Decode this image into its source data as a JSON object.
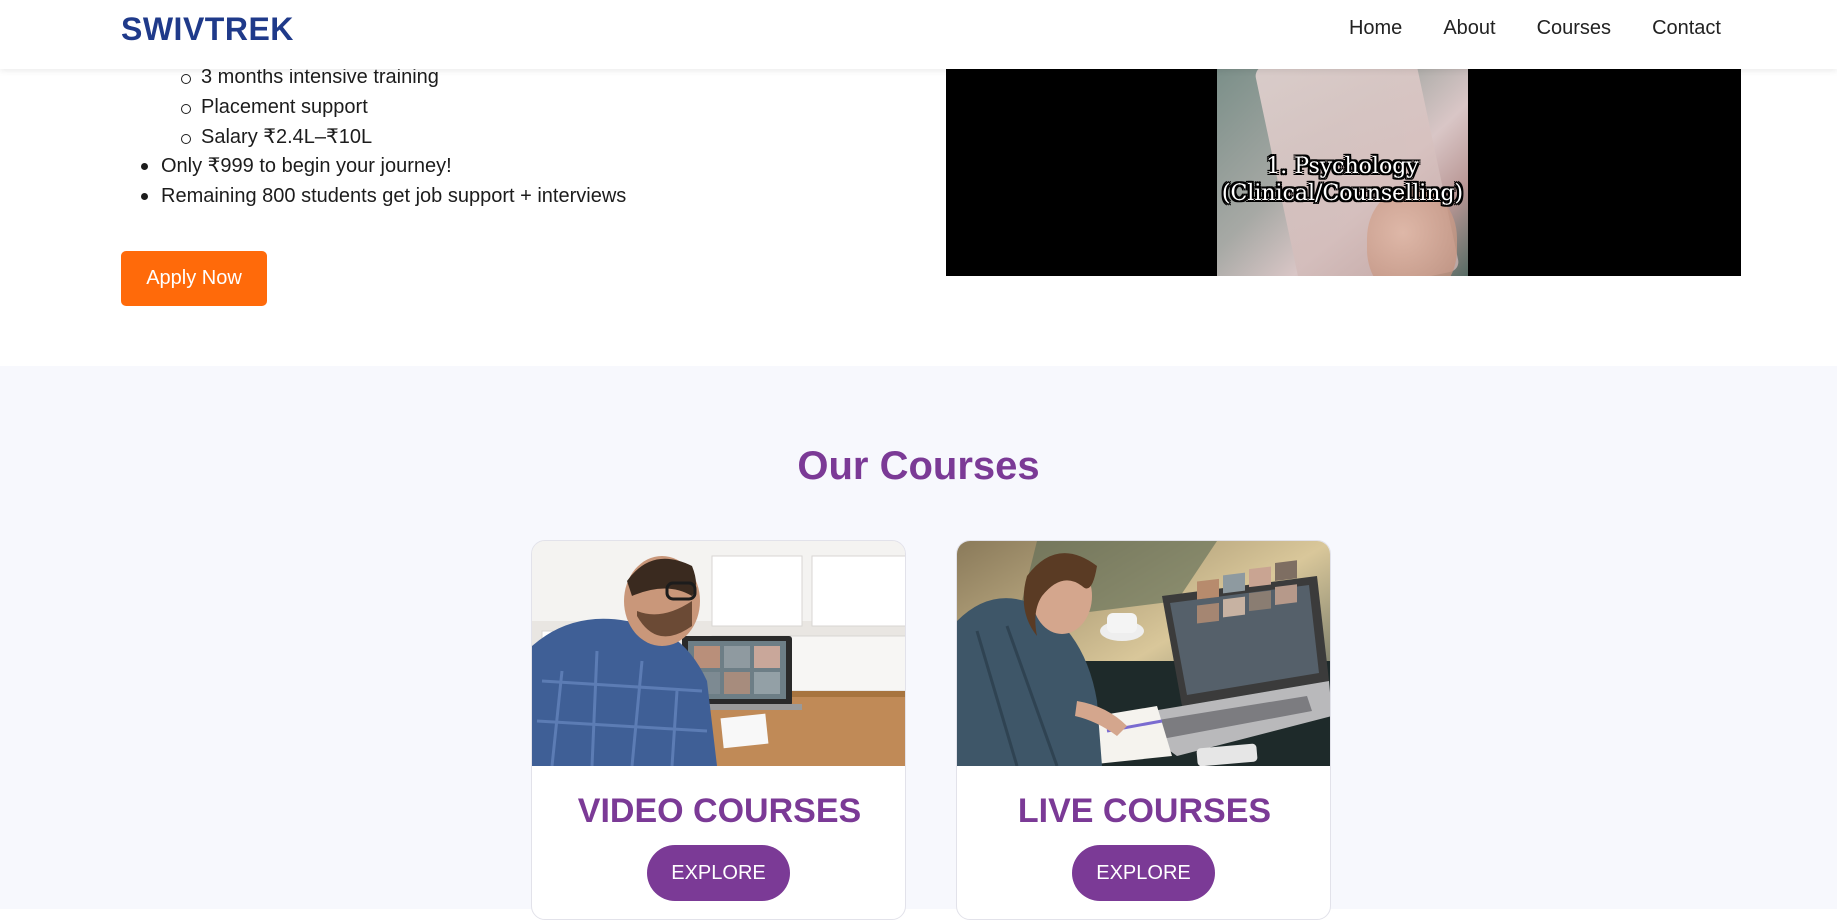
{
  "header": {
    "brand": "SWIVTREK",
    "nav": [
      "Home",
      "About",
      "Courses",
      "Contact"
    ]
  },
  "hero": {
    "sub_items": [
      "3 months intensive training",
      "Placement support",
      "Salary ₹2.4L–₹10L"
    ],
    "main_items": [
      "Only ₹999 to begin your journey!",
      "Remaining 800 students get job support + interviews"
    ],
    "apply_label": "Apply Now",
    "video_caption_line1": "1. Psychology",
    "video_caption_line2": "(Clinical/Counselling)"
  },
  "courses": {
    "title": "Our Courses",
    "cards": [
      {
        "title": "VIDEO COURSES",
        "button": "EXPLORE"
      },
      {
        "title": "LIVE COURSES",
        "button": "EXPLORE"
      }
    ]
  },
  "colors": {
    "brand": "#1f3a8a",
    "accent_orange": "#ff6a0a",
    "accent_purple": "#7b3a96"
  }
}
